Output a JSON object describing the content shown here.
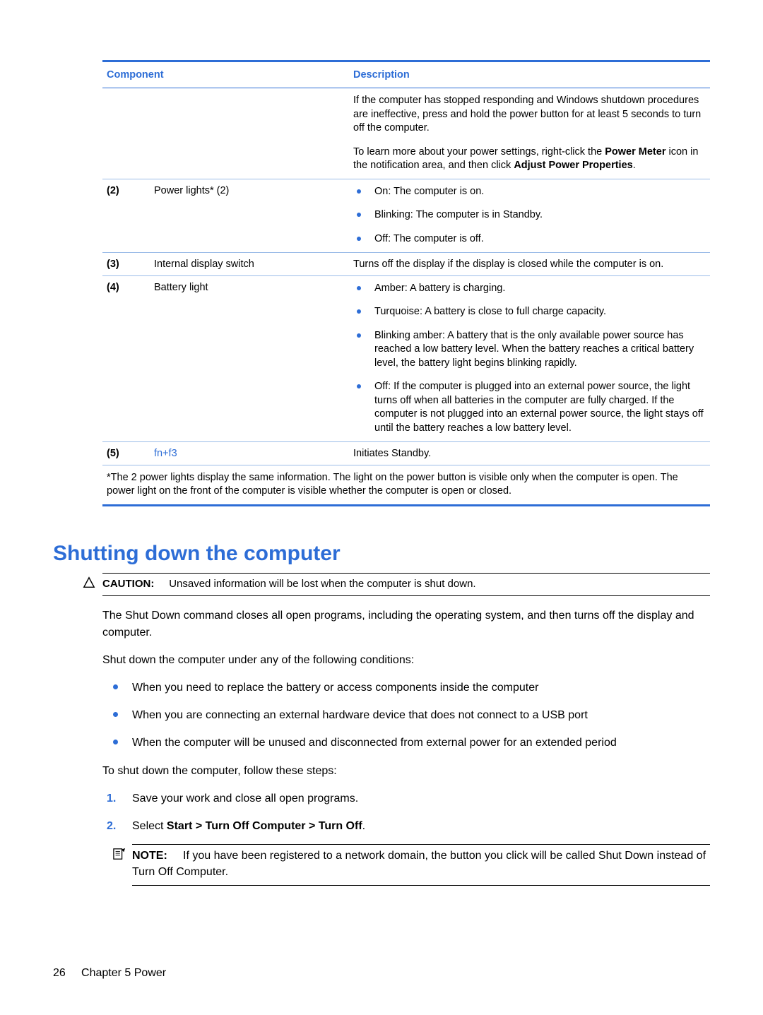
{
  "table": {
    "headers": {
      "component": "Component",
      "description": "Description"
    },
    "row1": {
      "p1_a": "If the computer has stopped responding and Windows shutdown procedures are ineffective, press and hold the power button for at least 5 seconds to turn off the computer.",
      "p2_a": "To learn more about your power settings, right-click the ",
      "p2_b": "Power Meter",
      "p2_c": " icon in the notification area, and then click ",
      "p2_d": "Adjust Power Properties",
      "p2_e": "."
    },
    "row2": {
      "num": "(2)",
      "comp": "Power lights* (2)",
      "b1": "On: The computer is on.",
      "b2": "Blinking: The computer is in Standby.",
      "b3": "Off: The computer is off."
    },
    "row3": {
      "num": "(3)",
      "comp": "Internal display switch",
      "desc": "Turns off the display if the display is closed while the computer is on."
    },
    "row4": {
      "num": "(4)",
      "comp": "Battery light",
      "b1": "Amber: A battery is charging.",
      "b2": "Turquoise: A battery is close to full charge capacity.",
      "b3": "Blinking amber: A battery that is the only available power source has reached a low battery level. When the battery reaches a critical battery level, the battery light begins blinking rapidly.",
      "b4": "Off: If the computer is plugged into an external power source, the light turns off when all batteries in the computer are fully charged. If the computer is not plugged into an external power source, the light stays off until the battery reaches a low battery level."
    },
    "row5": {
      "num": "(5)",
      "comp": "fn+f3",
      "desc": "Initiates Standby."
    },
    "footnote": "*The 2 power lights display the same information. The light on the power button is visible only when the computer is open. The power light on the front of the computer is visible whether the computer is open or closed."
  },
  "heading": "Shutting down the computer",
  "caution": {
    "label": "CAUTION:",
    "text": "Unsaved information will be lost when the computer is shut down."
  },
  "body": {
    "p1": "The Shut Down command closes all open programs, including the operating system, and then turns off the display and computer.",
    "p2": "Shut down the computer under any of the following conditions:",
    "b1": "When you need to replace the battery or access components inside the computer",
    "b2": "When you are connecting an external hardware device that does not connect to a USB port",
    "b3": "When the computer will be unused and disconnected from external power for an extended period",
    "p3": "To shut down the computer, follow these steps:",
    "step1": "Save your work and close all open programs.",
    "step2_a": "Select ",
    "step2_b": "Start > Turn Off Computer > Turn Off",
    "step2_c": "."
  },
  "note": {
    "label": "NOTE:",
    "text": "If you have been registered to a network domain, the button you click will be called Shut Down instead of Turn Off Computer."
  },
  "footer": {
    "pagenum": "26",
    "chapter": "Chapter 5   Power"
  }
}
